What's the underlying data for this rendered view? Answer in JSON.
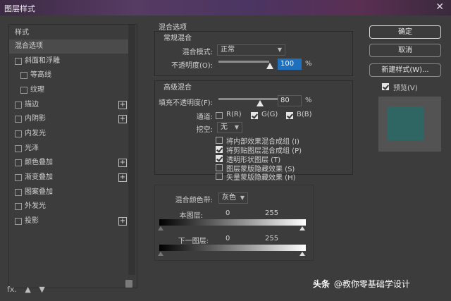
{
  "window": {
    "title": "图层样式",
    "close_glyph": "✕"
  },
  "left_panel": {
    "header": "样式",
    "items": [
      {
        "label": "混合选项",
        "checkbox": false,
        "plus": false,
        "selected": true,
        "indent": 0
      },
      {
        "label": "斜面和浮雕",
        "checkbox": true,
        "plus": false,
        "indent": 0
      },
      {
        "label": "等高线",
        "checkbox": true,
        "plus": false,
        "indent": 1
      },
      {
        "label": "纹理",
        "checkbox": true,
        "plus": false,
        "indent": 1
      },
      {
        "label": "描边",
        "checkbox": true,
        "plus": true,
        "indent": 0
      },
      {
        "label": "内阴影",
        "checkbox": true,
        "plus": true,
        "indent": 0
      },
      {
        "label": "内发光",
        "checkbox": true,
        "plus": false,
        "indent": 0
      },
      {
        "label": "光泽",
        "checkbox": true,
        "plus": false,
        "indent": 0
      },
      {
        "label": "颜色叠加",
        "checkbox": true,
        "plus": true,
        "indent": 0
      },
      {
        "label": "渐变叠加",
        "checkbox": true,
        "plus": true,
        "indent": 0
      },
      {
        "label": "图案叠加",
        "checkbox": true,
        "plus": false,
        "indent": 0
      },
      {
        "label": "外发光",
        "checkbox": true,
        "plus": false,
        "indent": 0
      },
      {
        "label": "投影",
        "checkbox": true,
        "plus": true,
        "indent": 0
      }
    ],
    "footer_fx": "fx.",
    "plus_glyph": "+"
  },
  "blend": {
    "section_title": "混合选项",
    "general_title": "常规混合",
    "mode_label": "混合模式:",
    "mode_value": "正常",
    "opacity_label": "不透明度(O):",
    "opacity_value": "100",
    "opacity_unit": "%",
    "advanced_title": "高级混合",
    "fill_label": "填充不透明度(F):",
    "fill_value": "80",
    "fill_unit": "%",
    "channels_label": "通道:",
    "channels": [
      {
        "label": "R(R)",
        "checked": false
      },
      {
        "label": "G(G)",
        "checked": true
      },
      {
        "label": "B(B)",
        "checked": true
      }
    ],
    "knockout_label": "挖空:",
    "knockout_value": "无",
    "options": [
      {
        "label": "将内部效果混合成组 (I)",
        "checked": false
      },
      {
        "label": "将剪贴图层混合成组 (P)",
        "checked": true
      },
      {
        "label": "透明形状图层 (T)",
        "checked": true
      },
      {
        "label": "图层蒙版隐藏效果 (S)",
        "checked": false
      },
      {
        "label": "矢量蒙版隐藏效果 (H)",
        "checked": false
      }
    ],
    "blend_if_label": "混合颜色带:",
    "blend_if_value": "灰色",
    "this_layer_label": "本图层:",
    "this_layer_min": "0",
    "this_layer_max": "255",
    "under_layer_label": "下一图层:",
    "under_layer_min": "0",
    "under_layer_max": "255"
  },
  "buttons": {
    "ok": "确定",
    "cancel": "取消",
    "new_style": "新建样式(W)...",
    "preview_label": "预览(V)",
    "preview_checked": true
  },
  "colors": {
    "preview_swatch": "#2f6663",
    "accent": "#1f6fbf"
  },
  "watermark": {
    "brand": "头条",
    "text": "@教你零基础学设计"
  }
}
